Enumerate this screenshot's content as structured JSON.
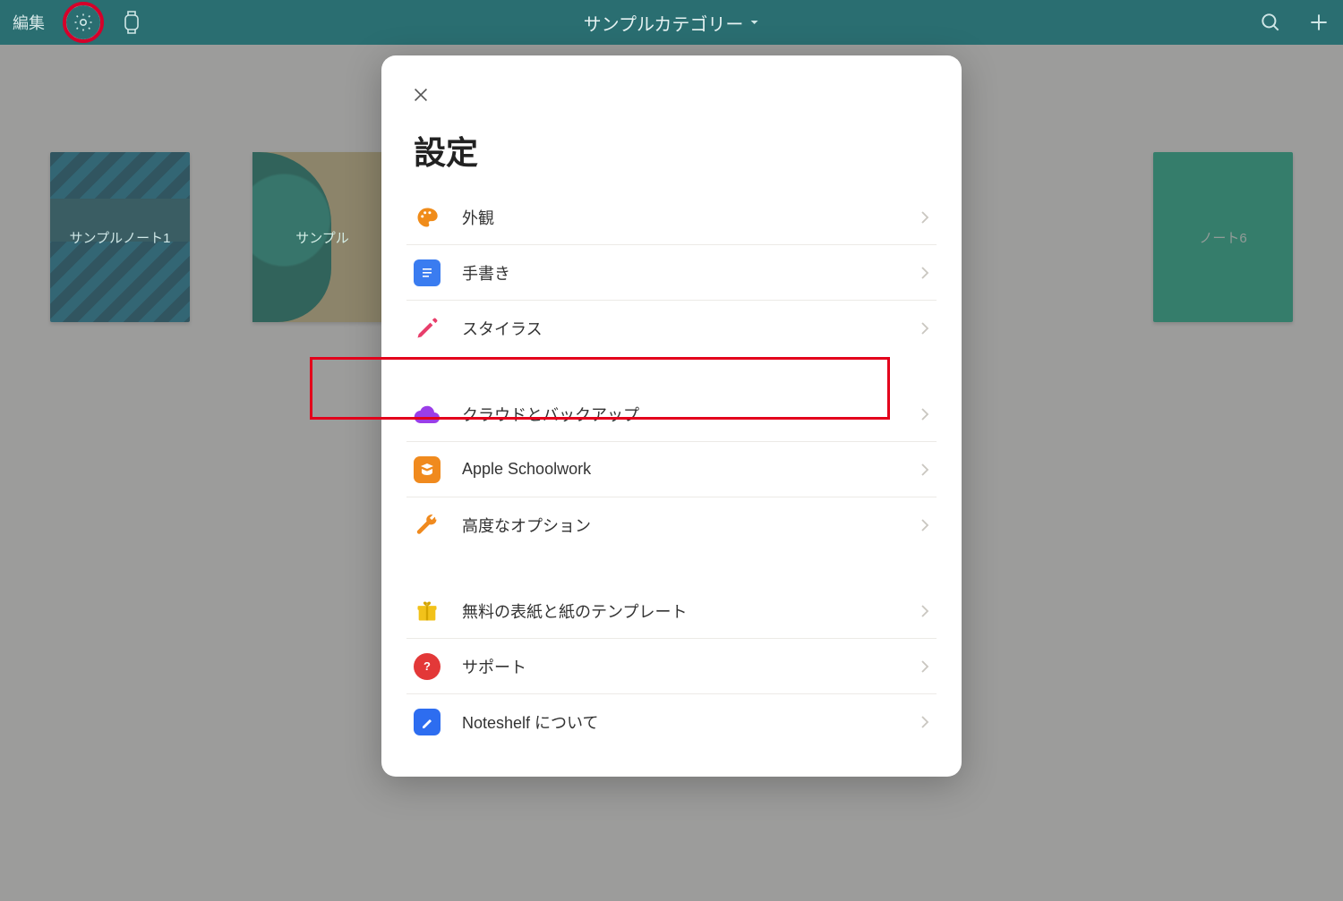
{
  "toolbar": {
    "edit_label": "編集",
    "category_title": "サンプルカテゴリー"
  },
  "notebooks": [
    {
      "label": "サンプルノート1"
    },
    {
      "label": "サンプル"
    },
    {
      "label": "ノート6"
    }
  ],
  "modal": {
    "title": "設定"
  },
  "settings": {
    "group1": [
      {
        "icon": "palette",
        "icon_name": "palette-icon",
        "label": "外観"
      },
      {
        "icon": "doc",
        "icon_name": "document-icon",
        "label": "手書き"
      },
      {
        "icon": "pencil",
        "icon_name": "pencil-icon",
        "label": "スタイラス"
      }
    ],
    "group2": [
      {
        "icon": "cloud",
        "icon_name": "cloud-icon",
        "label": "クラウドとバックアップ",
        "highlighted": true
      },
      {
        "icon": "schoolwork",
        "icon_name": "schoolwork-icon",
        "label": "Apple Schoolwork"
      },
      {
        "icon": "wrench",
        "icon_name": "wrench-icon",
        "label": "高度なオプション"
      }
    ],
    "group3": [
      {
        "icon": "gift",
        "icon_name": "gift-icon",
        "label": "無料の表紙と紙のテンプレート"
      },
      {
        "icon": "help",
        "icon_name": "help-icon",
        "label": "サポート"
      },
      {
        "icon": "noteshelf",
        "icon_name": "noteshelf-icon",
        "label": "Noteshelf について"
      }
    ]
  }
}
